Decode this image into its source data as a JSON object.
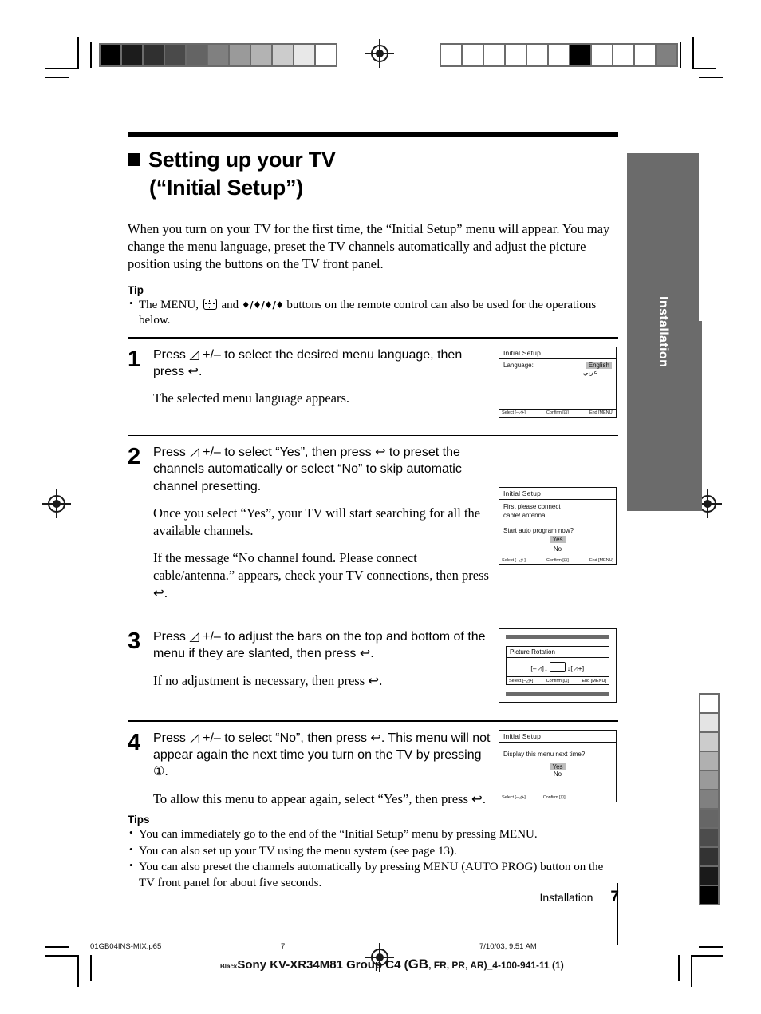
{
  "heading": {
    "line1": "Setting up your TV",
    "line2": "(“Initial Setup”)"
  },
  "intro": "When you turn on your TV for the first time, the “Initial Setup” menu will appear. You may change the menu language, preset the TV channels automatically and adjust the picture position using the buttons on the TV front panel.",
  "tip": {
    "heading": "Tip",
    "items": [
      "The MENU,  ⊕  and ♦/♦/♦/♦ buttons on the remote control can also be used for the operations below."
    ],
    "item1_a": "The MENU,",
    "item1_b": "and",
    "item1_arrows": "♦/♦/♦/♦",
    "item1_c": "buttons on the remote control can also be used for the operations below."
  },
  "steps": [
    {
      "num": "1",
      "lead": "Press ◿ +/– to select the desired menu language, then press ↩.",
      "note": "The selected menu language appears.",
      "osd": {
        "title": "Initial Setup",
        "label": "Language:",
        "value": "English",
        "value2": "عربي",
        "bar_select": "Select [–◿+]",
        "bar_confirm": "Confirm [⊡]",
        "bar_end": "End [MENU]"
      }
    },
    {
      "num": "2",
      "lead": "Press ◿ +/– to select “Yes”, then press ↩ to preset the channels automatically or select “No” to skip automatic channel presetting.",
      "note": "Once you select “Yes”, your TV will start searching for all the available channels.",
      "note2": "If the message “No channel found. Please connect cable/antenna.” appears, check your TV connections, then press ↩.",
      "osd": {
        "title": "Initial Setup",
        "l1": "First please connect",
        "l2": "cable/ antenna",
        "l3": "Start auto program now?",
        "yes": "Yes",
        "no": "No",
        "bar_select": "Select [–◿+]",
        "bar_confirm": "Confirm [⊡]",
        "bar_end": "End [MENU]"
      }
    },
    {
      "num": "3",
      "lead": "Press ◿ +/–  to adjust the bars on the top and bottom of the menu if they are slanted, then press ↩.",
      "note": "If no adjustment is necessary, then press ↩.",
      "osd": {
        "title": "Picture Rotation",
        "adj_left": "[–◿]",
        "adj_right": "[◿+]",
        "bar_select": "Select [–◿+]",
        "bar_confirm": "Confirm [⊡]",
        "bar_end": "End [MENU]"
      }
    },
    {
      "num": "4",
      "lead": "Press ◿ +/–  to select “No”, then press ↩. This menu will not appear again the next time you turn on the TV by pressing ①.",
      "note": "To allow this menu to appear again, select “Yes”, then press ↩.",
      "osd": {
        "title": "Initial Setup",
        "l1": "Display this menu next time?",
        "yes": "Yes",
        "no": "No",
        "bar_select": "Select [–◿+]",
        "bar_confirm": "Confirm [⊡]"
      }
    }
  ],
  "tips": {
    "heading": "Tips",
    "items": [
      "You can immediately go to the end of the “Initial Setup” menu by pressing MENU.",
      "You can also set up your TV using the menu system (see page 13).",
      "You can also preset the channels automatically by pressing MENU (AUTO PROG) button on the TV front panel for about five seconds."
    ]
  },
  "thumb_tab": {
    "label": "Installation"
  },
  "footer": {
    "section": "Installation",
    "page": "7",
    "file": "01GB04INS-MIX.p65",
    "folio": "7",
    "timestamp": "7/10/03, 9:51 AM",
    "imprint_black": "Black",
    "imprint_main": "Sony KV-XR34M81 Group C4 (",
    "imprint_gb": "GB",
    "imprint_rest": ", FR, PR, AR)_4-100-941-11 (1)"
  },
  "colors": {
    "tab_gray": "#6b6b6b",
    "osd_highlight": "#bdbdbd",
    "ink": "#000000"
  },
  "wedge_top_left": [
    "#000000",
    "#1c1c1c",
    "#303030",
    "#4a4a4a",
    "#646464",
    "#808080",
    "#9a9a9a",
    "#b3b3b3",
    "#cccccc",
    "#e8e8e8",
    "#ffffff"
  ],
  "wedge_top_right": [
    "#ffffff",
    "#ffffff",
    "#ffffff",
    "#ffffff",
    "#ffffff",
    "#ffffff",
    "#000000",
    "#ffffff",
    "#ffffff",
    "#ffffff",
    "#808080"
  ],
  "wedge_right_vertical": [
    "#ffffff",
    "#e4e4e4",
    "#cccccc",
    "#b0b0b0",
    "#9a9a9a",
    "#808080",
    "#666666",
    "#4c4c4c",
    "#333333",
    "#1a1a1a",
    "#000000"
  ]
}
